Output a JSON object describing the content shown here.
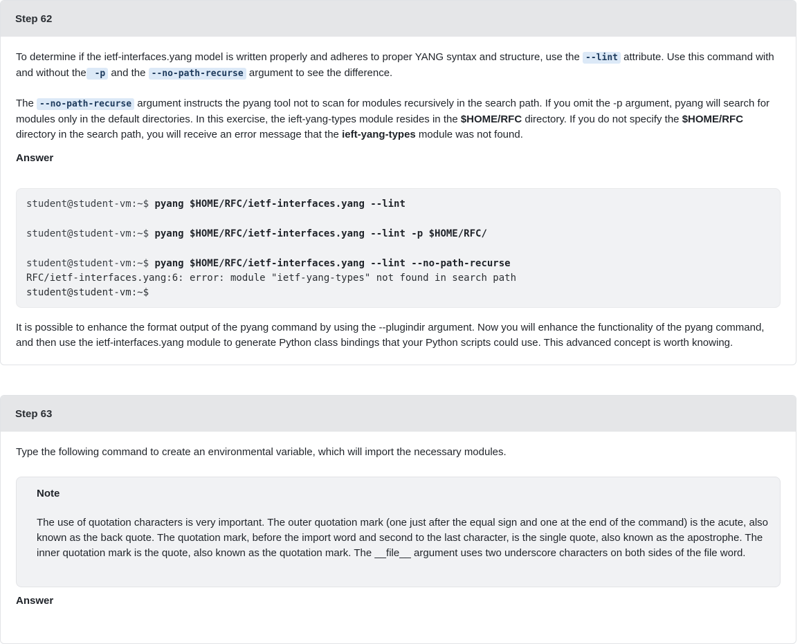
{
  "step62": {
    "title": "Step 62",
    "para1": {
      "t1": "To determine if the ietf-interfaces.yang model is written properly and adheres to proper YANG syntax and structure, use the ",
      "code1": "--lint",
      "t2": " attribute. Use this command with and without the",
      "code2": " -p",
      "t3": " and the ",
      "code3": "--no-path-recurse",
      "t4": " argument to see the difference."
    },
    "para2": {
      "t0": "The ",
      "code1": "--no-path-recurse",
      "t1": " argument instructs the pyang tool not to scan for modules recursively in the search path. If you omit the -p argument, pyang will search for modules only in the default directories. In this exercise, the ieft-yang-types module resides in the ",
      "b1": "$HOME/RFC",
      "t2": " directory. If you do not specify the ",
      "b2": "$HOME/RFC",
      "t3": " directory in the search path, you will receive an error message that the ",
      "b3": "ieft-yang-types",
      "t4": " module was not found."
    },
    "answer_label": "Answer",
    "code": {
      "prompt": "student@student-vm:~$ ",
      "cmd1": "pyang $HOME/RFC/ietf-interfaces.yang --lint",
      "cmd2": "pyang $HOME/RFC/ietf-interfaces.yang --lint -p $HOME/RFC/",
      "cmd3": "pyang $HOME/RFC/ietf-interfaces.yang --lint --no-path-recurse",
      "output1": "RFC/ietf-interfaces.yang:6: error: module \"ietf-yang-types\" not found in search path",
      "output2": "student@student-vm:~$"
    },
    "para3": "It is possible to enhance the format output of the pyang command by using the --plugindir argument. Now you will enhance the functionality of the pyang command, and then use the ietf-interfaces.yang module to generate Python class bindings that your Python scripts could use. This advanced concept is worth knowing."
  },
  "step63": {
    "title": "Step 63",
    "para1": "Type the following command to create an environmental variable, which will import the necessary modules.",
    "note": {
      "title": "Note",
      "text": "The use of quotation characters is very important. The outer quotation mark (one just after the equal sign and one at the end of the command) is the acute, also known as the back quote. The quotation mark, before the import word and second to the last character, is the single quote, also known as the apostrophe. The inner quotation mark is the quote, also known as the quotation mark. The __file__ argument uses two underscore characters on both sides of the file word."
    },
    "answer_label": "Answer"
  }
}
